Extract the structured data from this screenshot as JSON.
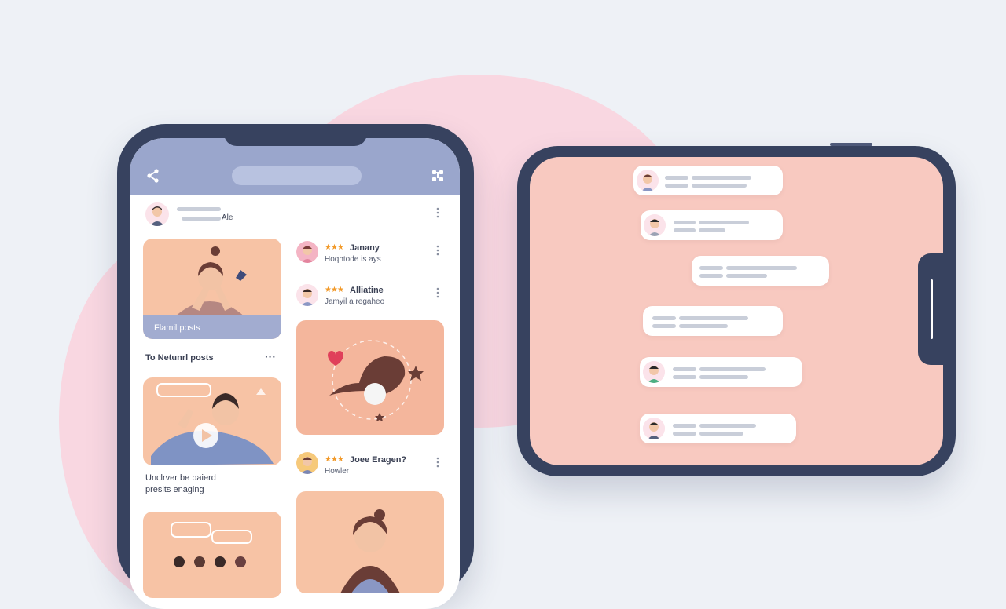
{
  "feed": {
    "header_user_suffix": "Ale",
    "featured_card_label": "Flamil posts",
    "section_title": "To Netunrl posts",
    "section_more_icon": "more-horizontal-icon",
    "caption_line1": "Unclrver be baierd",
    "caption_line2": "presits enaging",
    "posts": [
      {
        "name": "Janany",
        "subtitle": "Hoqhtode is ays",
        "rating": "★★★"
      },
      {
        "name": "Alliatine",
        "subtitle": "Jamyil a regaheo",
        "rating": "★★★"
      },
      {
        "name": "Joee Eragen?",
        "subtitle": "Howler",
        "rating": "★★★"
      }
    ]
  },
  "icons": {
    "share": "share-icon",
    "settings": "settings-icon",
    "more": "more-vertical-icon"
  },
  "colors": {
    "topbar": "#9aa6cc",
    "phone_frame": "#37425f",
    "chat_bg": "#f8c9c0",
    "card_peach": "#f7c3a5",
    "accent_pink": "#f9d7e1"
  }
}
